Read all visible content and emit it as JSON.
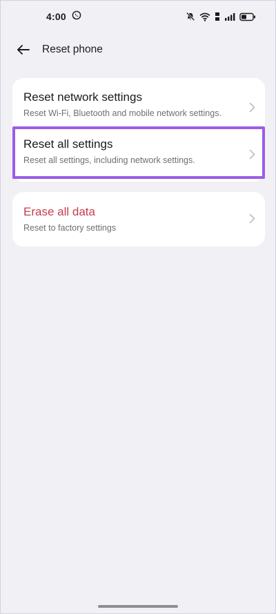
{
  "status_bar": {
    "time": "4:00",
    "icons": [
      "whatsapp-icon",
      "mute-bell-icon",
      "wifi-icon",
      "volte-icon",
      "signal-icon",
      "battery-icon"
    ]
  },
  "header": {
    "title": "Reset phone",
    "back_icon": "arrow-left-icon"
  },
  "sections": [
    {
      "items": [
        {
          "title": "Reset network settings",
          "subtitle": "Reset Wi-Fi, Bluetooth and mobile network settings."
        },
        {
          "title": "Reset all settings",
          "subtitle": "Reset all settings, including network settings.",
          "highlighted": true
        }
      ]
    },
    {
      "items": [
        {
          "title": "Erase all data",
          "subtitle": "Reset to factory settings",
          "color": "#c63c4e"
        }
      ]
    }
  ],
  "colors": {
    "background": "#f1f0f5",
    "card": "#ffffff",
    "highlight": "#9b5de5",
    "danger": "#c63c4e"
  }
}
